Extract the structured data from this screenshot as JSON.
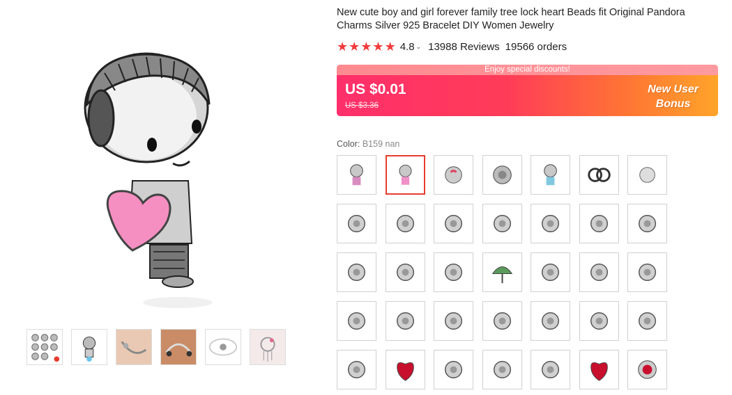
{
  "product": {
    "title": "New cute boy and girl forever family tree lock heart Beads fit Original Pandora Charms Silver 925 Bracelet DIY Women Jewelry",
    "rating": "4.8",
    "reviews": "13988 Reviews",
    "orders": "19566 orders"
  },
  "banner": {
    "top_text": "Enjoy special discounts!",
    "price": "US $0.01",
    "old_price": "US $3.36",
    "bonus_line1": "New User",
    "bonus_line2": "Bonus"
  },
  "color": {
    "label": "Color:",
    "selected_value": "B159 nan"
  },
  "colors": {
    "star": "#f23b3b",
    "selected_border": "#e63c2e",
    "banner_start": "#ff2f6b",
    "banner_end": "#ffa42a"
  },
  "icons": {
    "star": "★",
    "chevron": "⌄"
  },
  "gallery": {
    "thumb_count": 6
  },
  "swatch_grid": {
    "rows": 5,
    "cols": 7,
    "selected_index": 1
  }
}
